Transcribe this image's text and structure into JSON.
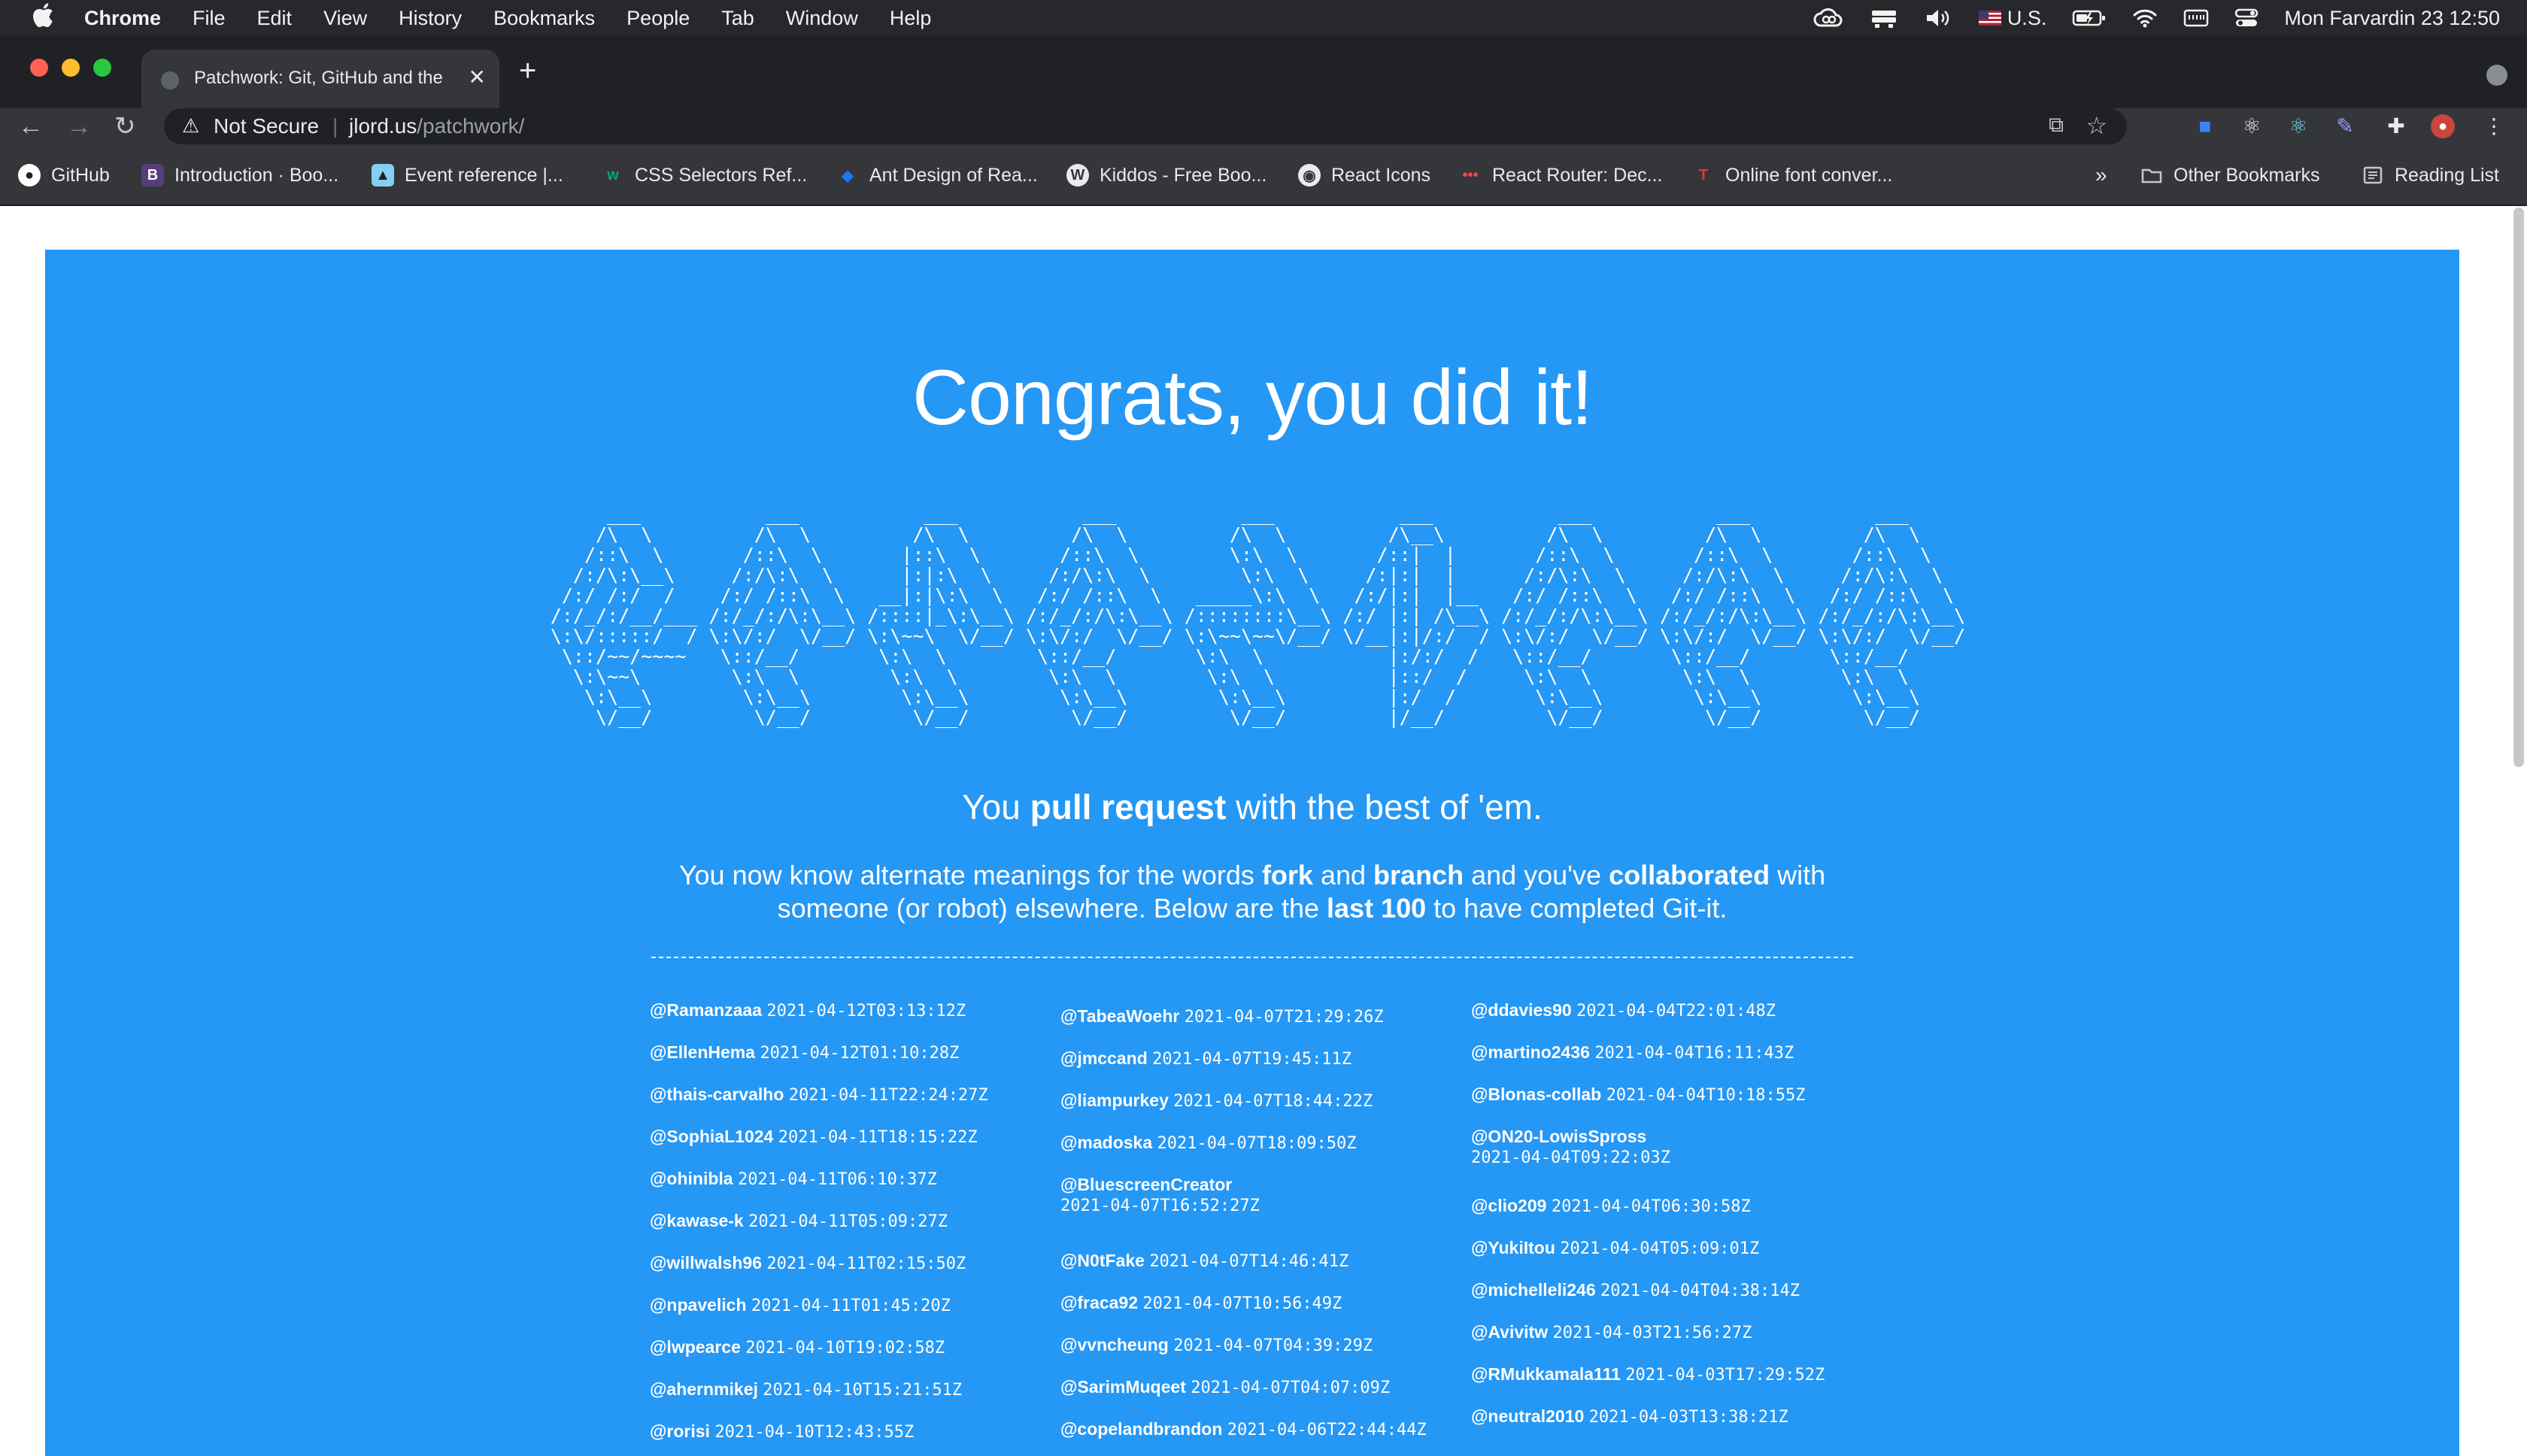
{
  "menubar": {
    "apple": "",
    "app_name": "Chrome",
    "menus": [
      "File",
      "Edit",
      "View",
      "History",
      "Bookmarks",
      "People",
      "Tab",
      "Window",
      "Help"
    ],
    "input_source": "U.S.",
    "datetime": "Mon Farvardin 23  12:50"
  },
  "tabs": [
    {
      "title": "Patchwork: Git, GitHub and the",
      "active": true
    }
  ],
  "new_tab_label": "+",
  "address_bar": {
    "security_label": "Not Secure",
    "url_host": "jlord.us",
    "url_path": "/patchwork/"
  },
  "bookmarks": [
    {
      "label": "GitHub",
      "icon": "github-icon"
    },
    {
      "label": "Introduction · Boo...",
      "icon": "bootstrap-icon"
    },
    {
      "label": "Event reference |...",
      "icon": "mdn-icon"
    },
    {
      "label": "CSS Selectors Ref...",
      "icon": "w3schools-icon"
    },
    {
      "label": "Ant Design of Rea...",
      "icon": "ant-design-icon"
    },
    {
      "label": "Kiddos - Free Boo...",
      "icon": "wordpress-icon"
    },
    {
      "label": "React Icons",
      "icon": "react-icons-icon"
    },
    {
      "label": "React Router: Dec...",
      "icon": "react-router-icon"
    },
    {
      "label": "Online font conver...",
      "icon": "font-converter-icon"
    }
  ],
  "bookmarks_overflow": "»",
  "other_bookmarks": "Other Bookmarks",
  "reading_list": "Reading List",
  "page": {
    "headline": "Congrats, you did it!",
    "ascii_art": "      ___           ___           ___           ___           ___           ___           ___           ___           ___     \n     /\\  \\         /\\  \\         /\\  \\         /\\  \\         /\\  \\         /\\__\\         /\\  \\         /\\  \\         /\\  \\    \n    /::\\  \\       /::\\  \\       |::\\  \\       /::\\  \\        \\:\\  \\       /::|  |       /::\\  \\       /::\\  \\       /::\\  \\   \n   /:/\\:\\__\\     /:/\\:\\  \\      |:|:\\  \\     /:/\\:\\  \\        \\:\\  \\     /:|:|  |      /:/\\:\\  \\     /:/\\:\\  \\     /:/\\:\\  \\  \n  /:/ /:/  /    /:/ /::\\  \\   __|:|\\:\\  \\   /:/ /::\\  \\   _____\\:\\  \\   /:/|:|  |__   /:/ /::\\  \\   /:/ /::\\  \\   /:/ /::\\  \\ \n /:/_/:/__/___ /:/_/:/\\:\\__\\ /::::|_\\:\\__\\ /:/_/:/\\:\\__\\ /::::::::\\__\\ /:/ |:| /\\__\\ /:/_/:/\\:\\__\\ /:/_/:/\\:\\__\\ /:/_/:/\\:\\__\\\n \\:\\/:::::/  / \\:\\/:/  \\/__/ \\:\\~~\\  \\/__/ \\:\\/:/  \\/__/ \\:\\~~\\~~\\/__/ \\/__|:|/:/  / \\:\\/:/  \\/__/ \\:\\/:/  \\/__/ \\:\\/:/  \\/__/\n  \\::/~~/~~~~   \\::/__/       \\:\\  \\        \\::/__/       \\:\\  \\           |:/:/  /   \\::/__/       \\::/__/       \\::/__/     \n   \\:\\~~\\        \\:\\  \\        \\:\\  \\        \\:\\  \\        \\:\\  \\          |::/  /     \\:\\  \\        \\:\\  \\        \\:\\  \\     \n    \\:\\__\\        \\:\\__\\        \\:\\__\\        \\:\\__\\        \\:\\__\\         |:/  /       \\:\\__\\        \\:\\__\\        \\:\\__\\    \n     \\/__/         \\/__/         \\/__/         \\/__/         \\/__/         |/__/         \\/__/         \\/__/         \\/__/    ",
    "tagline_pre": "You ",
    "tagline_bold": "pull request",
    "tagline_post": " with the best of 'em.",
    "intro": {
      "t1": "You now know alternate meanings for the words ",
      "b1": "fork",
      "t2": " and ",
      "b2": "branch",
      "t3": " and you've ",
      "b3": "collaborated",
      "t4": " with someone (or robot) elsewhere. Below are the ",
      "b4": "last 100",
      "t5": " to have completed Git-it."
    },
    "columns": [
      [
        {
          "user": "@Ramanzaaa",
          "time": "2021-04-12T03:13:12Z"
        },
        {
          "user": "@EllenHema",
          "time": "2021-04-12T01:10:28Z"
        },
        {
          "user": "@thais-carvalho",
          "time": "2021-04-11T22:24:27Z"
        },
        {
          "user": "@SophiaL1024",
          "time": "2021-04-11T18:15:22Z"
        },
        {
          "user": "@ohinibla",
          "time": "2021-04-11T06:10:37Z"
        },
        {
          "user": "@kawase-k",
          "time": "2021-04-11T05:09:27Z"
        },
        {
          "user": "@willwalsh96",
          "time": "2021-04-11T02:15:50Z"
        },
        {
          "user": "@npavelich",
          "time": "2021-04-11T01:45:20Z"
        },
        {
          "user": "@lwpearce",
          "time": "2021-04-10T19:02:58Z"
        },
        {
          "user": "@ahernmikej",
          "time": "2021-04-10T15:21:51Z"
        },
        {
          "user": "@rorisi",
          "time": "2021-04-10T12:43:55Z"
        }
      ],
      [
        {
          "user": "@TabeaWoehr",
          "time": "2021-04-07T21:29:26Z"
        },
        {
          "user": "@jmccand",
          "time": "2021-04-07T19:45:11Z"
        },
        {
          "user": "@liampurkey",
          "time": "2021-04-07T18:44:22Z"
        },
        {
          "user": "@madoska",
          "time": "2021-04-07T18:09:50Z"
        },
        {
          "user": "@BluescreenCreator",
          "time": "2021-04-07T16:52:27Z"
        },
        {
          "user": "@N0tFake",
          "time": "2021-04-07T14:46:41Z"
        },
        {
          "user": "@fraca92",
          "time": "2021-04-07T10:56:49Z"
        },
        {
          "user": "@vvncheung",
          "time": "2021-04-07T04:39:29Z"
        },
        {
          "user": "@SarimMuqeet",
          "time": "2021-04-07T04:07:09Z"
        },
        {
          "user": "@copelandbrandon",
          "time": "2021-04-06T22:44:44Z"
        }
      ],
      [
        {
          "user": "@ddavies90",
          "time": "2021-04-04T22:01:48Z"
        },
        {
          "user": "@martino2436",
          "time": "2021-04-04T16:11:43Z"
        },
        {
          "user": "@Blonas-collab",
          "time": "2021-04-04T10:18:55Z"
        },
        {
          "user": "@ON20-LowisSpross",
          "time": "2021-04-04T09:22:03Z"
        },
        {
          "user": "@clio209",
          "time": "2021-04-04T06:30:58Z"
        },
        {
          "user": "@YukiItou",
          "time": "2021-04-04T05:09:01Z"
        },
        {
          "user": "@michelleli246",
          "time": "2021-04-04T04:38:14Z"
        },
        {
          "user": "@Avivitw",
          "time": "2021-04-03T21:56:27Z"
        },
        {
          "user": "@RMukkamala111",
          "time": "2021-04-03T17:29:52Z"
        },
        {
          "user": "@neutral2010",
          "time": "2021-04-03T13:38:21Z"
        }
      ]
    ]
  },
  "colors": {
    "page_background": "#2597f5",
    "chrome_dark": "#202124",
    "chrome_toolbar": "#35363a",
    "menubar": "#26282c"
  }
}
